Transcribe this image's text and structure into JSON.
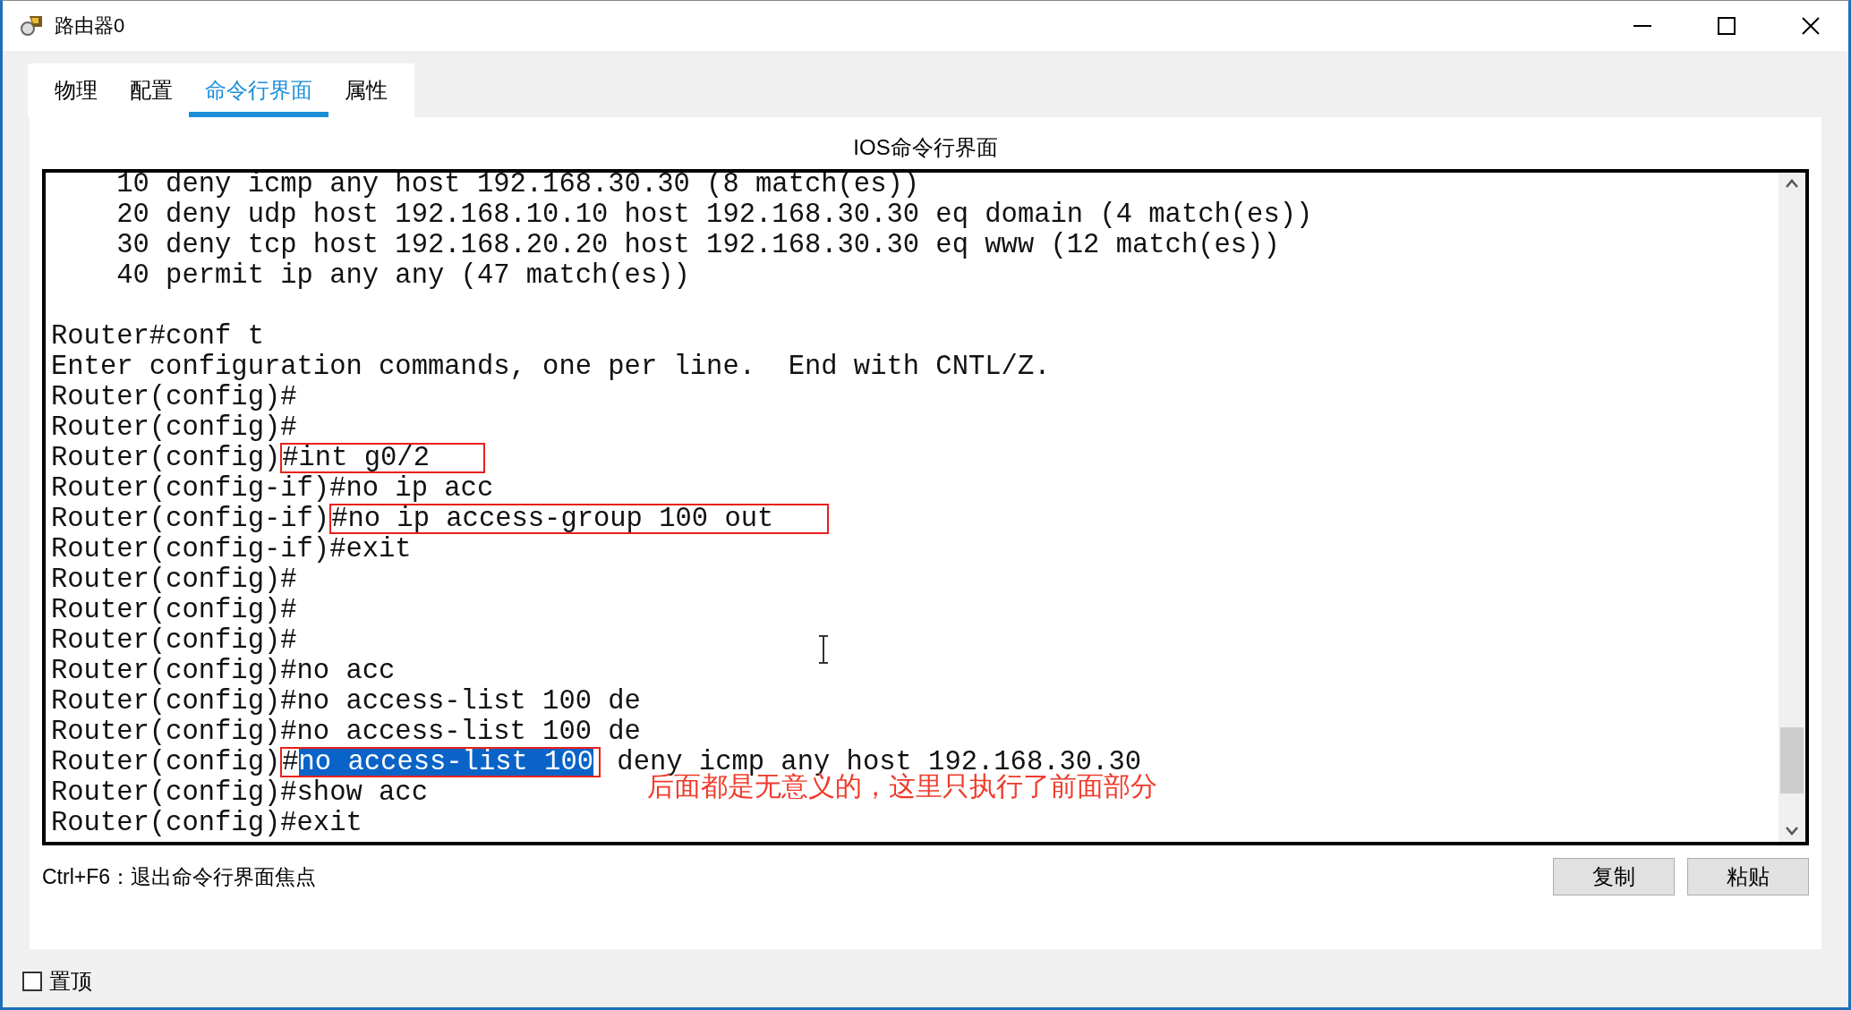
{
  "window": {
    "title": "路由器0"
  },
  "tabs": [
    {
      "label": "物理",
      "selected": false
    },
    {
      "label": "配置",
      "selected": false
    },
    {
      "label": "命令行界面",
      "selected": true
    },
    {
      "label": "属性",
      "selected": false
    }
  ],
  "panel_title": "IOS命令行界面",
  "terminal": {
    "lines": [
      {
        "kind": "text",
        "parts": [
          {
            "text": "    10 deny icmp any host 192.168.30.30 (8 match(es))",
            "boxed": false,
            "selected": false
          }
        ]
      },
      {
        "kind": "text",
        "parts": [
          {
            "text": "    20 deny udp host 192.168.10.10 host 192.168.30.30 eq domain (4 match(es))",
            "boxed": false,
            "selected": false
          }
        ]
      },
      {
        "kind": "text",
        "parts": [
          {
            "text": "    30 deny tcp host 192.168.20.20 host 192.168.30.30 eq www (12 match(es))",
            "boxed": false,
            "selected": false
          }
        ]
      },
      {
        "kind": "text",
        "parts": [
          {
            "text": "    40 permit ip any any (47 match(es))",
            "boxed": false,
            "selected": false
          }
        ]
      },
      {
        "kind": "blank"
      },
      {
        "kind": "text",
        "parts": [
          {
            "text": "Router#conf t",
            "boxed": false,
            "selected": false
          }
        ]
      },
      {
        "kind": "text",
        "parts": [
          {
            "text": "Enter configuration commands, one per line.  End with CNTL/Z.",
            "boxed": false,
            "selected": false
          }
        ]
      },
      {
        "kind": "text",
        "parts": [
          {
            "text": "Router(config)#",
            "boxed": false,
            "selected": false
          }
        ]
      },
      {
        "kind": "text",
        "parts": [
          {
            "text": "Router(config)#",
            "boxed": false,
            "selected": false
          }
        ]
      },
      {
        "kind": "text",
        "parts": [
          {
            "text": "Router(config)",
            "boxed": false,
            "selected": false
          },
          {
            "text": "#int g0/2",
            "boxed": true,
            "selected": false
          }
        ]
      },
      {
        "kind": "text",
        "parts": [
          {
            "text": "Router(config-if)#no ip acc",
            "boxed": false,
            "selected": false
          }
        ]
      },
      {
        "kind": "text",
        "parts": [
          {
            "text": "Router(config-if)",
            "boxed": false,
            "selected": false
          },
          {
            "text": "#no ip access-group 100 out",
            "boxed": true,
            "selected": false
          }
        ]
      },
      {
        "kind": "text",
        "parts": [
          {
            "text": "Router(config-if)#exit",
            "boxed": false,
            "selected": false
          }
        ]
      },
      {
        "kind": "text",
        "parts": [
          {
            "text": "Router(config)#",
            "boxed": false,
            "selected": false
          }
        ]
      },
      {
        "kind": "text",
        "parts": [
          {
            "text": "Router(config)#",
            "boxed": false,
            "selected": false
          }
        ]
      },
      {
        "kind": "text",
        "parts": [
          {
            "text": "Router(config)#",
            "boxed": false,
            "selected": false
          }
        ]
      },
      {
        "kind": "text",
        "parts": [
          {
            "text": "Router(config)#no acc",
            "boxed": false,
            "selected": false
          }
        ]
      },
      {
        "kind": "text",
        "parts": [
          {
            "text": "Router(config)#no access-list 100 de",
            "boxed": false,
            "selected": false
          }
        ]
      },
      {
        "kind": "text",
        "parts": [
          {
            "text": "Router(config)#no access-list 100 de",
            "boxed": false,
            "selected": false
          }
        ]
      },
      {
        "kind": "text",
        "parts": [
          {
            "text": "Router(config)",
            "boxed": false,
            "selected": false
          },
          {
            "text": "#",
            "boxed": true,
            "selected": false
          },
          {
            "text": "no access-list 100",
            "boxed": true,
            "selected": true
          },
          {
            "text": " deny icmp any host 192.168.30.30",
            "boxed": false,
            "selected": false
          }
        ]
      },
      {
        "kind": "text",
        "parts": [
          {
            "text": "Router(config)#show acc",
            "boxed": false,
            "selected": false
          }
        ]
      },
      {
        "kind": "text",
        "parts": [
          {
            "text": "Router(config)#exit",
            "boxed": false,
            "selected": false
          }
        ]
      }
    ],
    "annotation": "后面都是无意义的，这里只执行了前面部分"
  },
  "hint": "Ctrl+F6：退出命令行界面焦点",
  "buttons": [
    "复制",
    "粘贴"
  ],
  "always_on_top": {
    "label": "置顶",
    "checked": false
  }
}
